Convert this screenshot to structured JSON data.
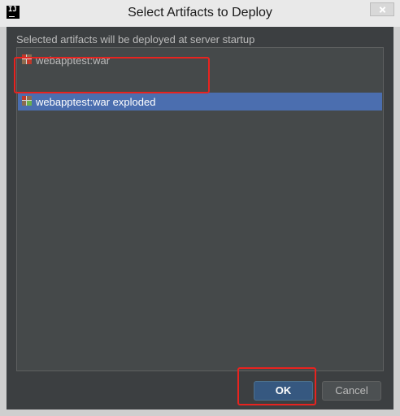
{
  "window": {
    "title": "Select Artifacts to Deploy",
    "app_icon": "intellij-idea-icon",
    "app_icon_text": "IJ"
  },
  "dialog": {
    "subtitle": "Selected artifacts will be deployed at server startup",
    "artifacts": [
      {
        "label": "webapptest:war",
        "icon": "war-artifact-icon",
        "selected": false
      },
      {
        "label": "webapptest:war exploded",
        "icon": "war-exploded-artifact-icon",
        "selected": true
      }
    ]
  },
  "buttons": {
    "ok_label": "OK",
    "cancel_label": "Cancel"
  },
  "colors": {
    "background": "#3c3f41",
    "selection": "#4b6eaf",
    "default_button": "#365880",
    "annotation_red": "#e8231f"
  }
}
